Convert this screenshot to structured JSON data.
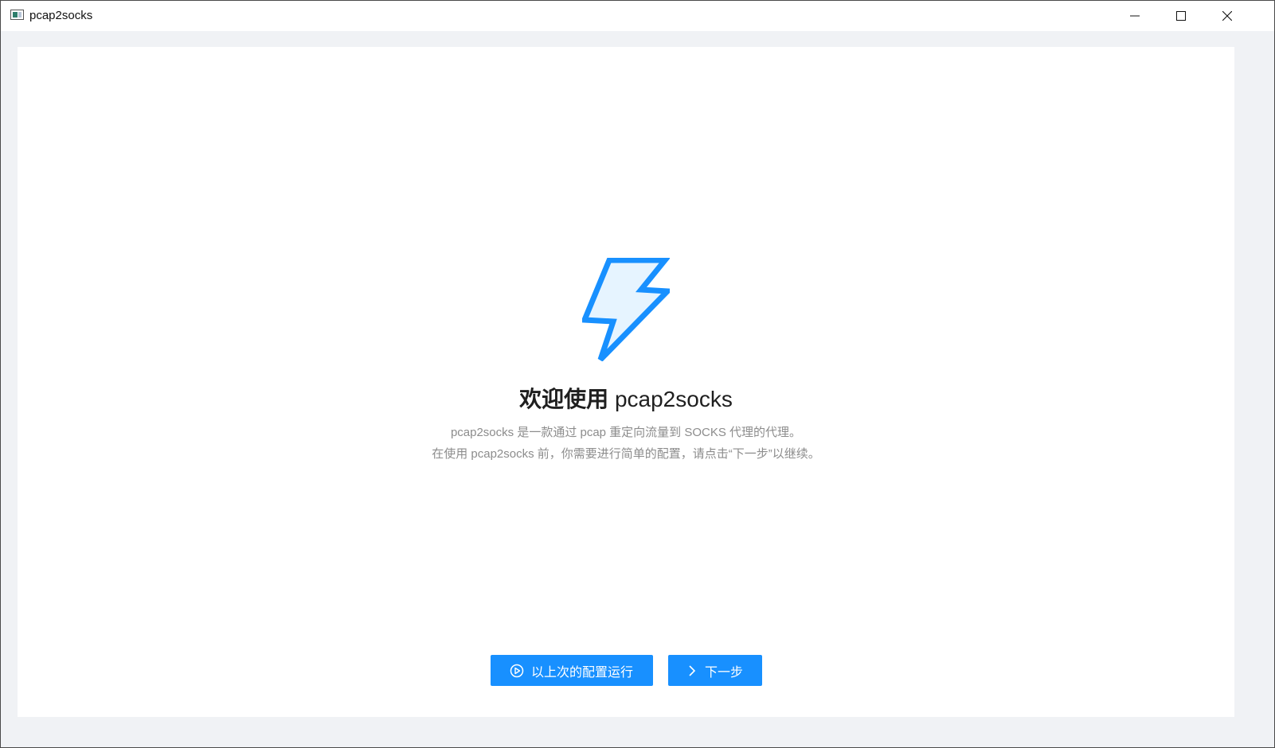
{
  "window": {
    "title": "pcap2socks",
    "controls": [
      "minimize-icon",
      "maximize-icon",
      "close-icon"
    ]
  },
  "welcome": {
    "icon": "lightning-bolt-icon",
    "title_prefix": "欢迎使用",
    "title_brand": "pcap2socks",
    "description_line1": "pcap2socks 是一款通过 pcap 重定向流量到 SOCKS 代理的代理。",
    "description_line2": "在使用 pcap2socks 前，你需要进行简单的配置，请点击“下一步”以继续。"
  },
  "actions": {
    "run_last_label": "以上次的配置运行",
    "run_last_icon": "play-circle-icon",
    "next_label": "下一步",
    "next_icon": "chevron-right-icon"
  },
  "colors": {
    "primary": "#1890ff",
    "background": "#f0f2f5",
    "bolt_fill": "#e6f4ff"
  }
}
